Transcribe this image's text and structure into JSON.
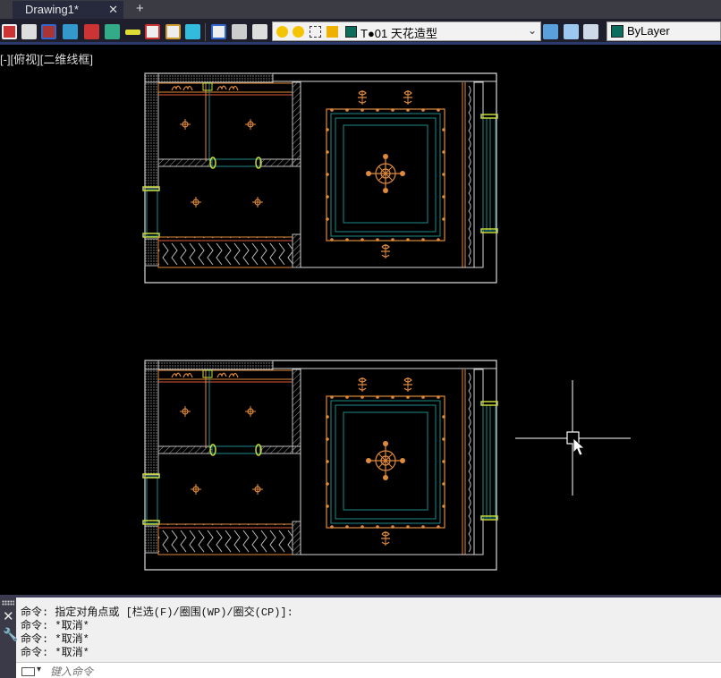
{
  "tabs": [
    {
      "label": "Drawing1*",
      "close": "✕"
    }
  ],
  "new_tab": "+",
  "toolbar": {
    "layer": {
      "name": "T●01 天花造型",
      "swatch_color": "#0b6d5b"
    },
    "color": {
      "label": "ByLayer",
      "swatch_color": "#0b6d5b"
    }
  },
  "viewport": {
    "label": "[-][俯视][二维线框]"
  },
  "command": {
    "history": [
      "命令: 指定对角点或 [栏选(F)/圈围(WP)/圈交(CP)]:",
      "命令: *取消*",
      "命令: *取消*",
      "命令: *取消*"
    ],
    "placeholder": "键入命令"
  }
}
